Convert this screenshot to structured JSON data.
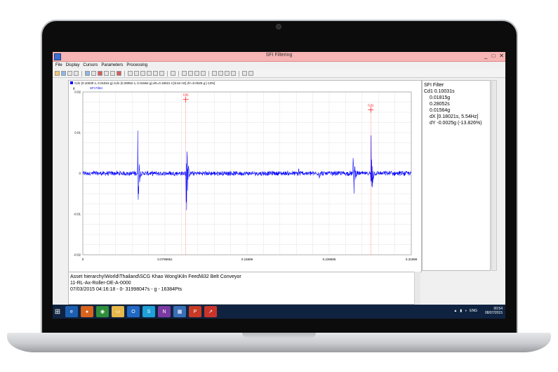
{
  "window": {
    "title": "SFI Filtering",
    "min": "_",
    "max": "□",
    "close": "✕"
  },
  "menu": {
    "items": [
      "File",
      "Display",
      "Cursors",
      "Parameters",
      "Processing"
    ]
  },
  "plot": {
    "cursor_readout": "Cd1 (0.10030 s, 0.01815 g)   Cd1 (0.28052 s, 0.01564 g)   dX=0.18021 s [5.54 Hz]   dY=0.0025 g [-13%]",
    "unit": "g",
    "legend": "SFI Filter",
    "cursor1_label": "Cd1",
    "cursor2_label": "Cd1"
  },
  "side_panel": {
    "title": "SFI Filter",
    "cd1": "Cd1  0.10031s",
    "v1": "0.01815g",
    "v2": "0.28052s",
    "v3": "0.01564g",
    "dx": "dX [0.18021s, 5.54Hz]",
    "dy": "dY -0.0025g (-13.826%)"
  },
  "info": {
    "line1": "Asset hierarchy\\World\\Thailand\\SCG Khao Wong\\Kiln Feed\\832 Belt Conveyor",
    "line2": "11-RL-Ax-Roller-DE-A-0000",
    "line3": "07/03/2015 04:16:18 - 0- 31998047s - g - 16384Pts"
  },
  "taskbar": {
    "lang": "ENG",
    "time": "00:54",
    "date": "08/07/2015"
  },
  "chart_data": {
    "type": "line",
    "title": "",
    "xlabel": "",
    "ylabel": "g",
    "xlim": [
      0,
      0.31998
    ],
    "ylim": [
      -0.02,
      0.02
    ],
    "x_ticks": [
      "0",
      "0.0799951",
      "0.15999",
      "0.239985",
      "0.31998"
    ],
    "y_ticks": [
      "0.02",
      "0.01",
      "0",
      "-0.01",
      "-0.02"
    ],
    "grid": true,
    "series": [
      {
        "name": "SFI Filter",
        "color": "#0000ff",
        "noise_amplitude": 0.0007,
        "bursts": [
          {
            "x": 0.01,
            "amp": 0.0016
          },
          {
            "x": 0.0488,
            "amp": 0.0012
          },
          {
            "x": 0.0535,
            "amp": 0.0125
          },
          {
            "x": 0.1005,
            "amp": 0.0183
          },
          {
            "x": 0.21,
            "amp": 0.0028
          },
          {
            "x": 0.23,
            "amp": 0.0022
          },
          {
            "x": 0.2635,
            "amp": 0.0101
          },
          {
            "x": 0.2806,
            "amp": 0.0165
          },
          {
            "x": 0.3005,
            "amp": 0.0013
          }
        ]
      }
    ],
    "cursors": [
      {
        "label": "Cd1",
        "x": 0.1003,
        "y": 0.01815,
        "color": "#ff0000"
      },
      {
        "label": "Cd1",
        "x": 0.28052,
        "y": 0.01564,
        "color": "#ff0000"
      }
    ]
  }
}
